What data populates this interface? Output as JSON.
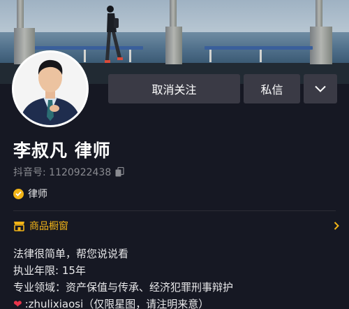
{
  "profile": {
    "name": "李叔凡 律师",
    "douyin_id": "抖音号: 1120922438",
    "verification": "律师"
  },
  "actions": {
    "unfollow": "取消关注",
    "message": "私信"
  },
  "shop": {
    "label": "商品橱窗"
  },
  "bio": {
    "line1": "法律很简单，帮您说说看",
    "line2": "执业年限: 15年",
    "line3": "专业领域：资产保值与传承、经济犯罪刑事辩护",
    "line4": ":zhulixiaosi（仅限星图，请注明来意）"
  },
  "colors": {
    "background": "#161823",
    "button": "#3a3a45",
    "accent_gold": "#f2b417",
    "heart": "#e8344a"
  },
  "icons": {
    "copy": "copy-icon",
    "verified": "verified-badge-icon",
    "shop": "shop-icon",
    "dropdown": "chevron-down-icon",
    "heart": "heart-icon"
  }
}
